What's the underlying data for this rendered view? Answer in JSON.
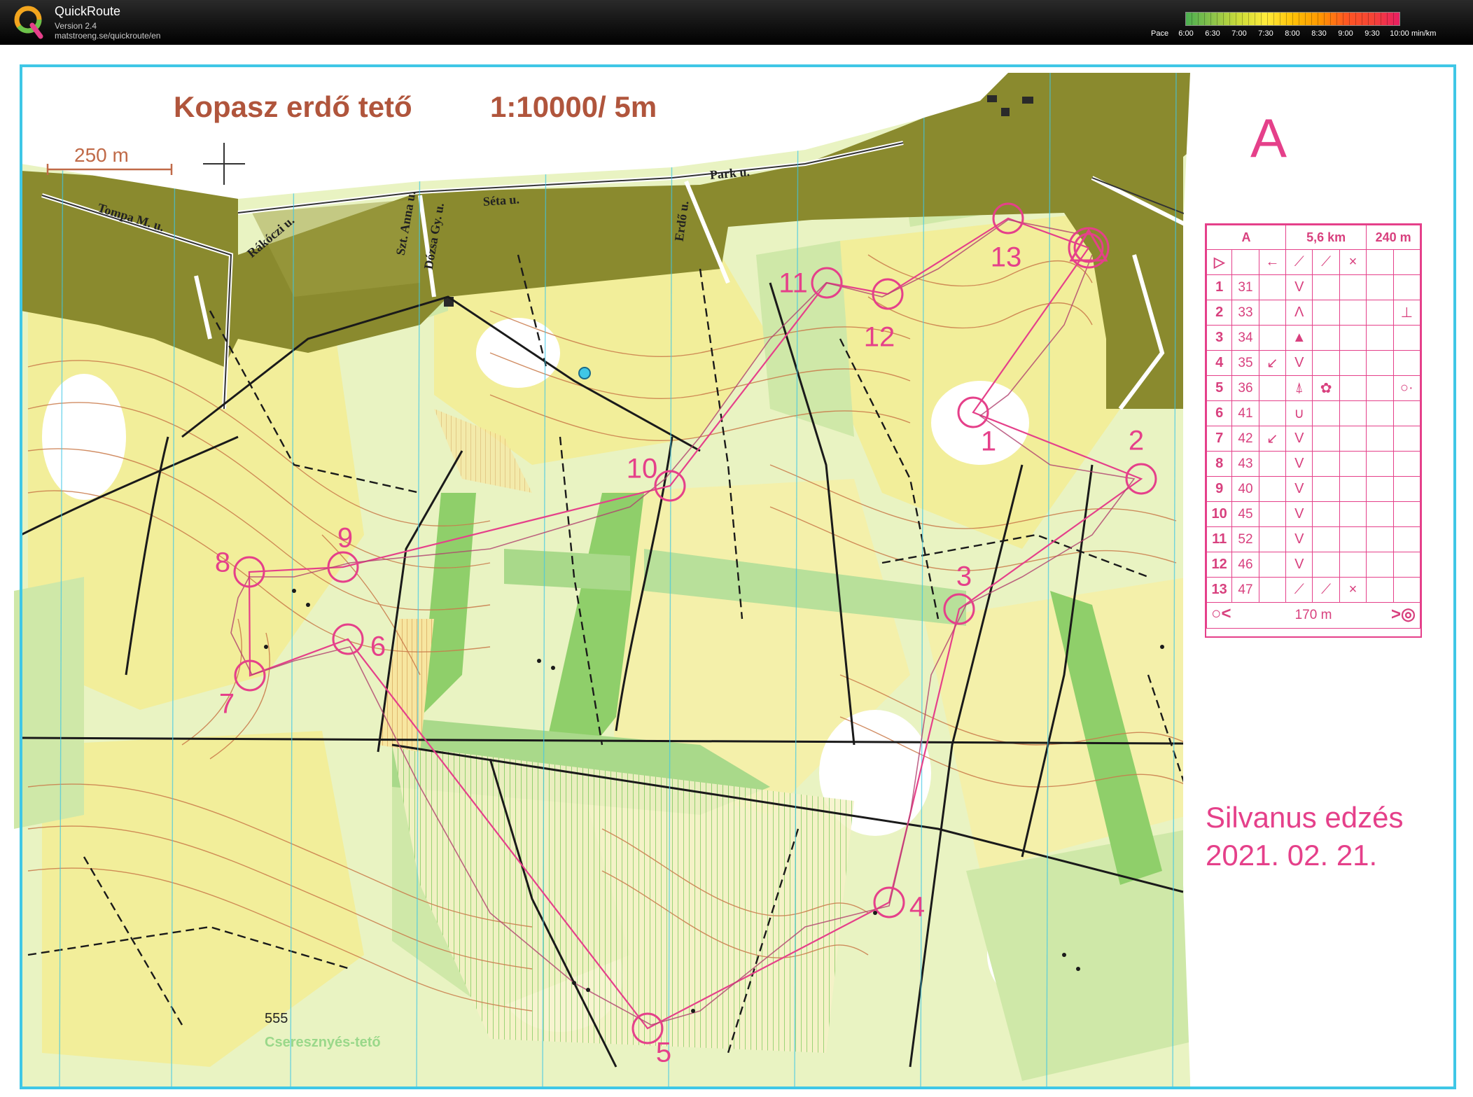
{
  "app": {
    "title": "QuickRoute",
    "version": "Version 2.4",
    "url": "matstroeng.se/quickroute/en"
  },
  "pace_legend": {
    "label": "Pace",
    "ticks": [
      "6:00",
      "6:30",
      "7:00",
      "7:30",
      "8:00",
      "8:30",
      "9:00",
      "9:30",
      "10:00"
    ],
    "unit": "min/km"
  },
  "map": {
    "title": "Kopasz erdő tető",
    "scale": "1:10000/ 5m",
    "scale_bar_label": "250 m",
    "course_letter": "A",
    "event_name": "Silvanus edzés",
    "event_date": "2021. 02. 21.",
    "spot_height": "555",
    "place_name": "Cseresznyés-tető",
    "streets": [
      "Tompa M. u.",
      "Rákóczi u.",
      "Szt. Anna u.",
      "Dózsa Gy. u.",
      "Séta u.",
      "Erdő u.",
      "Park u."
    ],
    "control_numbers": [
      "1",
      "2",
      "3",
      "4",
      "5",
      "6",
      "7",
      "8",
      "9",
      "10",
      "11",
      "12",
      "13"
    ]
  },
  "description_card": {
    "course": "A",
    "length": "5,6 km",
    "climb": "240 m",
    "start_symbols": [
      "▷",
      "←",
      "⟋",
      "⟋",
      "×"
    ],
    "controls": [
      {
        "num": "1",
        "code": "31",
        "dir": "",
        "feature": "V",
        "extra": "",
        "detail": "",
        "loc": ""
      },
      {
        "num": "2",
        "code": "33",
        "dir": "",
        "feature": "Λ",
        "extra": "",
        "detail": "",
        "loc": "⊥"
      },
      {
        "num": "3",
        "code": "34",
        "dir": "",
        "feature": "▲",
        "extra": "",
        "detail": "",
        "loc": ""
      },
      {
        "num": "4",
        "code": "35",
        "dir": "↙",
        "feature": "V",
        "extra": "",
        "detail": "",
        "loc": ""
      },
      {
        "num": "5",
        "code": "36",
        "dir": "",
        "feature": "⍋",
        "extra": "✿",
        "detail": "",
        "loc": "○·"
      },
      {
        "num": "6",
        "code": "41",
        "dir": "",
        "feature": "∪",
        "extra": "",
        "detail": "",
        "loc": ""
      },
      {
        "num": "7",
        "code": "42",
        "dir": "↙",
        "feature": "V",
        "extra": "",
        "detail": "",
        "loc": ""
      },
      {
        "num": "8",
        "code": "43",
        "dir": "",
        "feature": "V",
        "extra": "",
        "detail": "",
        "loc": ""
      },
      {
        "num": "9",
        "code": "40",
        "dir": "",
        "feature": "V",
        "extra": "",
        "detail": "",
        "loc": ""
      },
      {
        "num": "10",
        "code": "45",
        "dir": "",
        "feature": "V",
        "extra": "",
        "detail": "",
        "loc": ""
      },
      {
        "num": "11",
        "code": "52",
        "dir": "",
        "feature": "V",
        "extra": "",
        "detail": "",
        "loc": ""
      },
      {
        "num": "12",
        "code": "46",
        "dir": "",
        "feature": "V",
        "extra": "",
        "detail": "",
        "loc": ""
      },
      {
        "num": "13",
        "code": "47",
        "dir": "",
        "feature": "⟋",
        "extra": "⟋",
        "detail": "×",
        "loc": ""
      }
    ],
    "finish_distance": "170 m"
  },
  "colors": {
    "course_magenta": "#e5408a",
    "map_border": "#3fc7e6",
    "open_land": "#f4f0a0",
    "forest_green": "#cfe8a8",
    "dense_green": "#8fcf6a",
    "urban": "#8a8a2e",
    "contour": "#c97a4a"
  }
}
